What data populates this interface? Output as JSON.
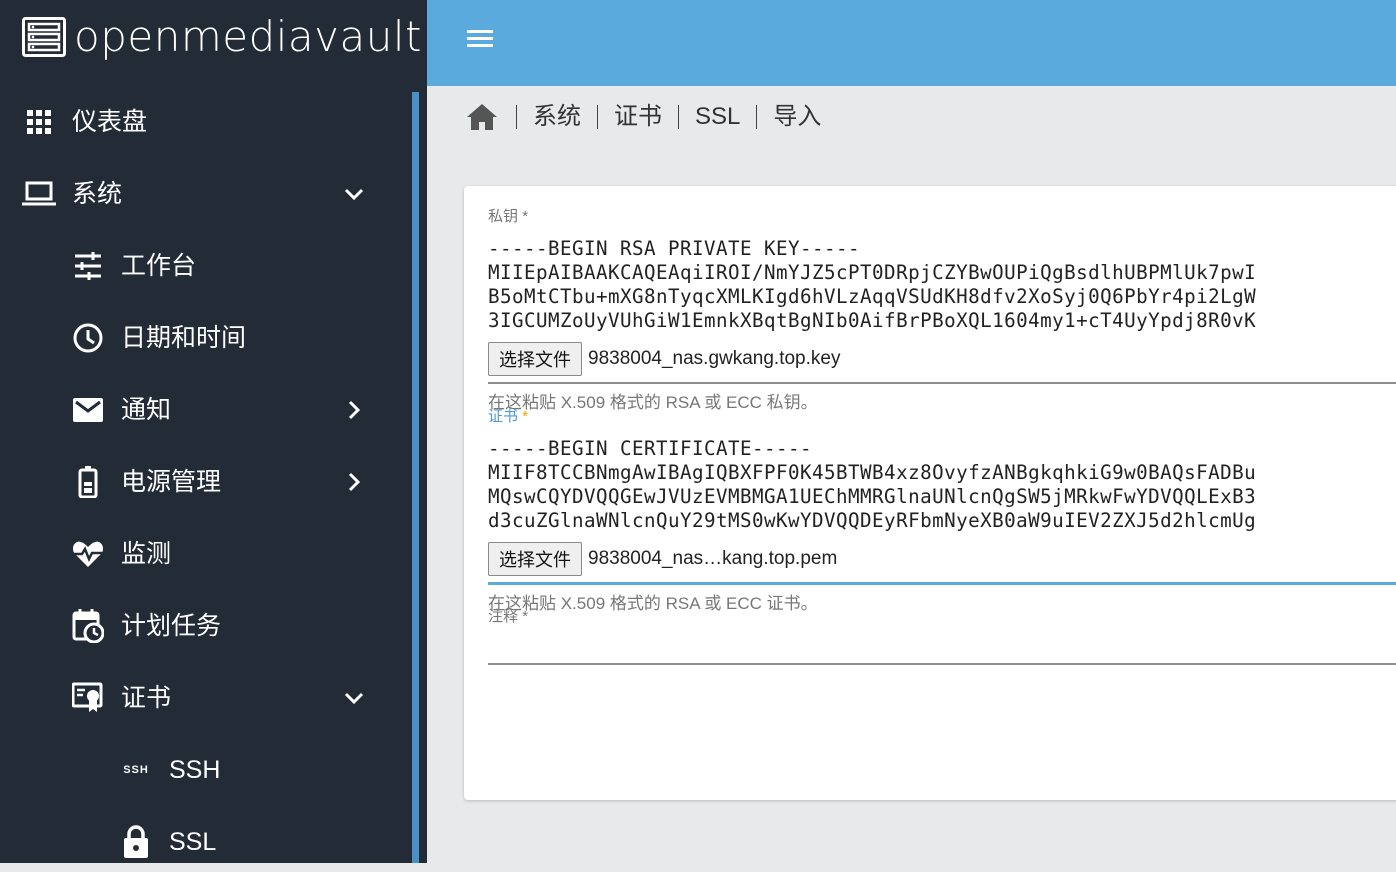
{
  "app": {
    "logo_text": "openmediavault",
    "colors": {
      "sidebar": "#222b36",
      "topbar": "#5aaade",
      "accent": "#4a9ad8",
      "required_active": "#e6a800"
    }
  },
  "sidebar": {
    "items": [
      {
        "label": "仪表盘",
        "icon": "dashboard-grid-icon"
      },
      {
        "label": "系统",
        "icon": "laptop-icon",
        "chevron": "chevron-down-icon"
      },
      {
        "label": "工作台",
        "icon": "sliders-icon"
      },
      {
        "label": "日期和时间",
        "icon": "clock-icon"
      },
      {
        "label": "通知",
        "icon": "mail-icon",
        "chevron": "chevron-right-icon"
      },
      {
        "label": "电源管理",
        "icon": "battery-icon",
        "chevron": "chevron-right-icon"
      },
      {
        "label": "监测",
        "icon": "heart-pulse-icon"
      },
      {
        "label": "计划任务",
        "icon": "calendar-clock-icon"
      },
      {
        "label": "证书",
        "icon": "certificate-icon",
        "chevron": "chevron-down-icon"
      },
      {
        "label": "SSH",
        "icon": "ssh-icon",
        "icon_text": "SSH"
      },
      {
        "label": "SSL",
        "icon": "lock-icon"
      }
    ]
  },
  "breadcrumb": {
    "items": [
      "系统",
      "证书",
      "SSL",
      "导入"
    ]
  },
  "form": {
    "private_key": {
      "label": "私钥",
      "required_mark": "*",
      "lines": [
        "-----BEGIN RSA PRIVATE KEY-----",
        "MIIEpAIBAAKCAQEAqiIROI/NmYJZ5cPT0DRpjCZYBwOUPiQgBsdlhUBPMlUk7pwI",
        "B5oMtCTbu+mXG8nTyqcXMLKIgd6hVLzAqqVSUdKH8dfv2XoSyj0Q6PbYr4pi2LgW",
        "3IGCUMZoUyVUhGiW1EmnkXBqtBgNIb0AifBrPBoXQL1604my1+cT4UyYpdj8R0vK"
      ],
      "file_button": "选择文件",
      "file_name": "9838004_nas.gwkang.top.key",
      "hint": "在这粘贴 X.509 格式的 RSA 或 ECC 私钥。"
    },
    "certificate": {
      "label": "证书",
      "required_mark": "*",
      "lines": [
        "-----BEGIN CERTIFICATE-----",
        "MIIF8TCCBNmgAwIBAgIQBXFPF0K45BTWB4xz8OvyfzANBgkqhkiG9w0BAQsFADBu",
        "MQswCQYDVQQGEwJVUzEVMBMGA1UEChMMRGlnaUNlcnQgSW5jMRkwFwYDVQQLExB3",
        "d3cuZGlnaWNlcnQuY29tMS0wKwYDVQQDEyRFbmNyeXB0aW9uIEV2ZXJ5d2hlcmUg"
      ],
      "file_button": "选择文件",
      "file_name": "9838004_nas…kang.top.pem",
      "hint": "在这粘贴 X.509 格式的 RSA 或 ECC 证书。"
    },
    "comment": {
      "label": "注释",
      "required_mark": "*",
      "value": ""
    }
  }
}
